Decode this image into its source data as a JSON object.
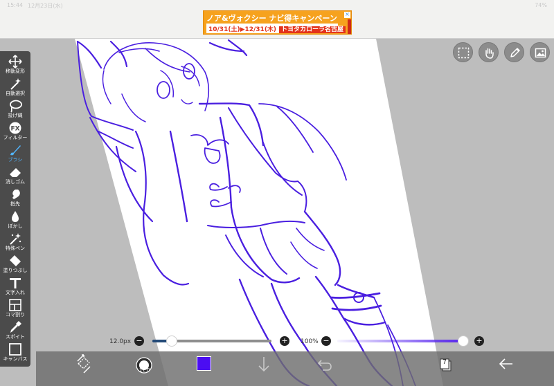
{
  "status_bar": {
    "time": "15:44",
    "date": "12月23日(水)",
    "battery": "74%"
  },
  "ad": {
    "headline": "ノア&ヴォクシー ナビ得キャンペーン",
    "dates": "10/31(土)▶12/31(木)",
    "dealer": "トヨタカローラ名古屋",
    "close": "×"
  },
  "toolbar": {
    "tools": [
      {
        "name": "move-transform",
        "label": "移動変形",
        "icon": "move-arrows-icon"
      },
      {
        "name": "auto-select",
        "label": "自動選択",
        "icon": "magic-wand-icon"
      },
      {
        "name": "lasso",
        "label": "投げ縄",
        "icon": "lasso-icon"
      },
      {
        "name": "filter",
        "label": "フィルター",
        "icon": "fx-icon"
      },
      {
        "name": "brush",
        "label": "ブラシ",
        "icon": "brush-icon",
        "active": true
      },
      {
        "name": "eraser",
        "label": "消しゴム",
        "icon": "eraser-icon"
      },
      {
        "name": "finger",
        "label": "指先",
        "icon": "finger-icon"
      },
      {
        "name": "blur",
        "label": "ぼかし",
        "icon": "drop-icon"
      },
      {
        "name": "special-pen",
        "label": "特殊ペン",
        "icon": "sparkle-pen-icon"
      },
      {
        "name": "fill",
        "label": "塗りつぶし",
        "icon": "bucket-icon"
      },
      {
        "name": "text",
        "label": "文字入れ",
        "icon": "text-icon"
      },
      {
        "name": "frame",
        "label": "コマ割り",
        "icon": "frame-icon"
      },
      {
        "name": "eyedropper",
        "label": "スポイト",
        "icon": "eyedropper-icon"
      },
      {
        "name": "canvas",
        "label": "キャンバス",
        "icon": "canvas-icon"
      }
    ]
  },
  "top_tools": [
    {
      "name": "selection-tool",
      "icon": "selection-dashed-icon"
    },
    {
      "name": "hand-tool",
      "icon": "hand-icon"
    },
    {
      "name": "pencil-tool",
      "icon": "pencil-icon"
    },
    {
      "name": "image-tool",
      "icon": "image-icon"
    }
  ],
  "brush": {
    "size_label": "12.0px",
    "size_fraction": 0.16,
    "opacity_label": "100%",
    "opacity_fraction": 1.0,
    "minus": "−",
    "plus": "+",
    "preview_size": "12.0"
  },
  "bottom_bar": {
    "layer_count": "7",
    "current_color": "#4b0df2"
  },
  "colors": {
    "stroke": "#4a1fe0",
    "toolbar_bg": "#4b4b4b",
    "active_tool": "#52b6ff",
    "canvas_bg": "#bdbdbd"
  }
}
